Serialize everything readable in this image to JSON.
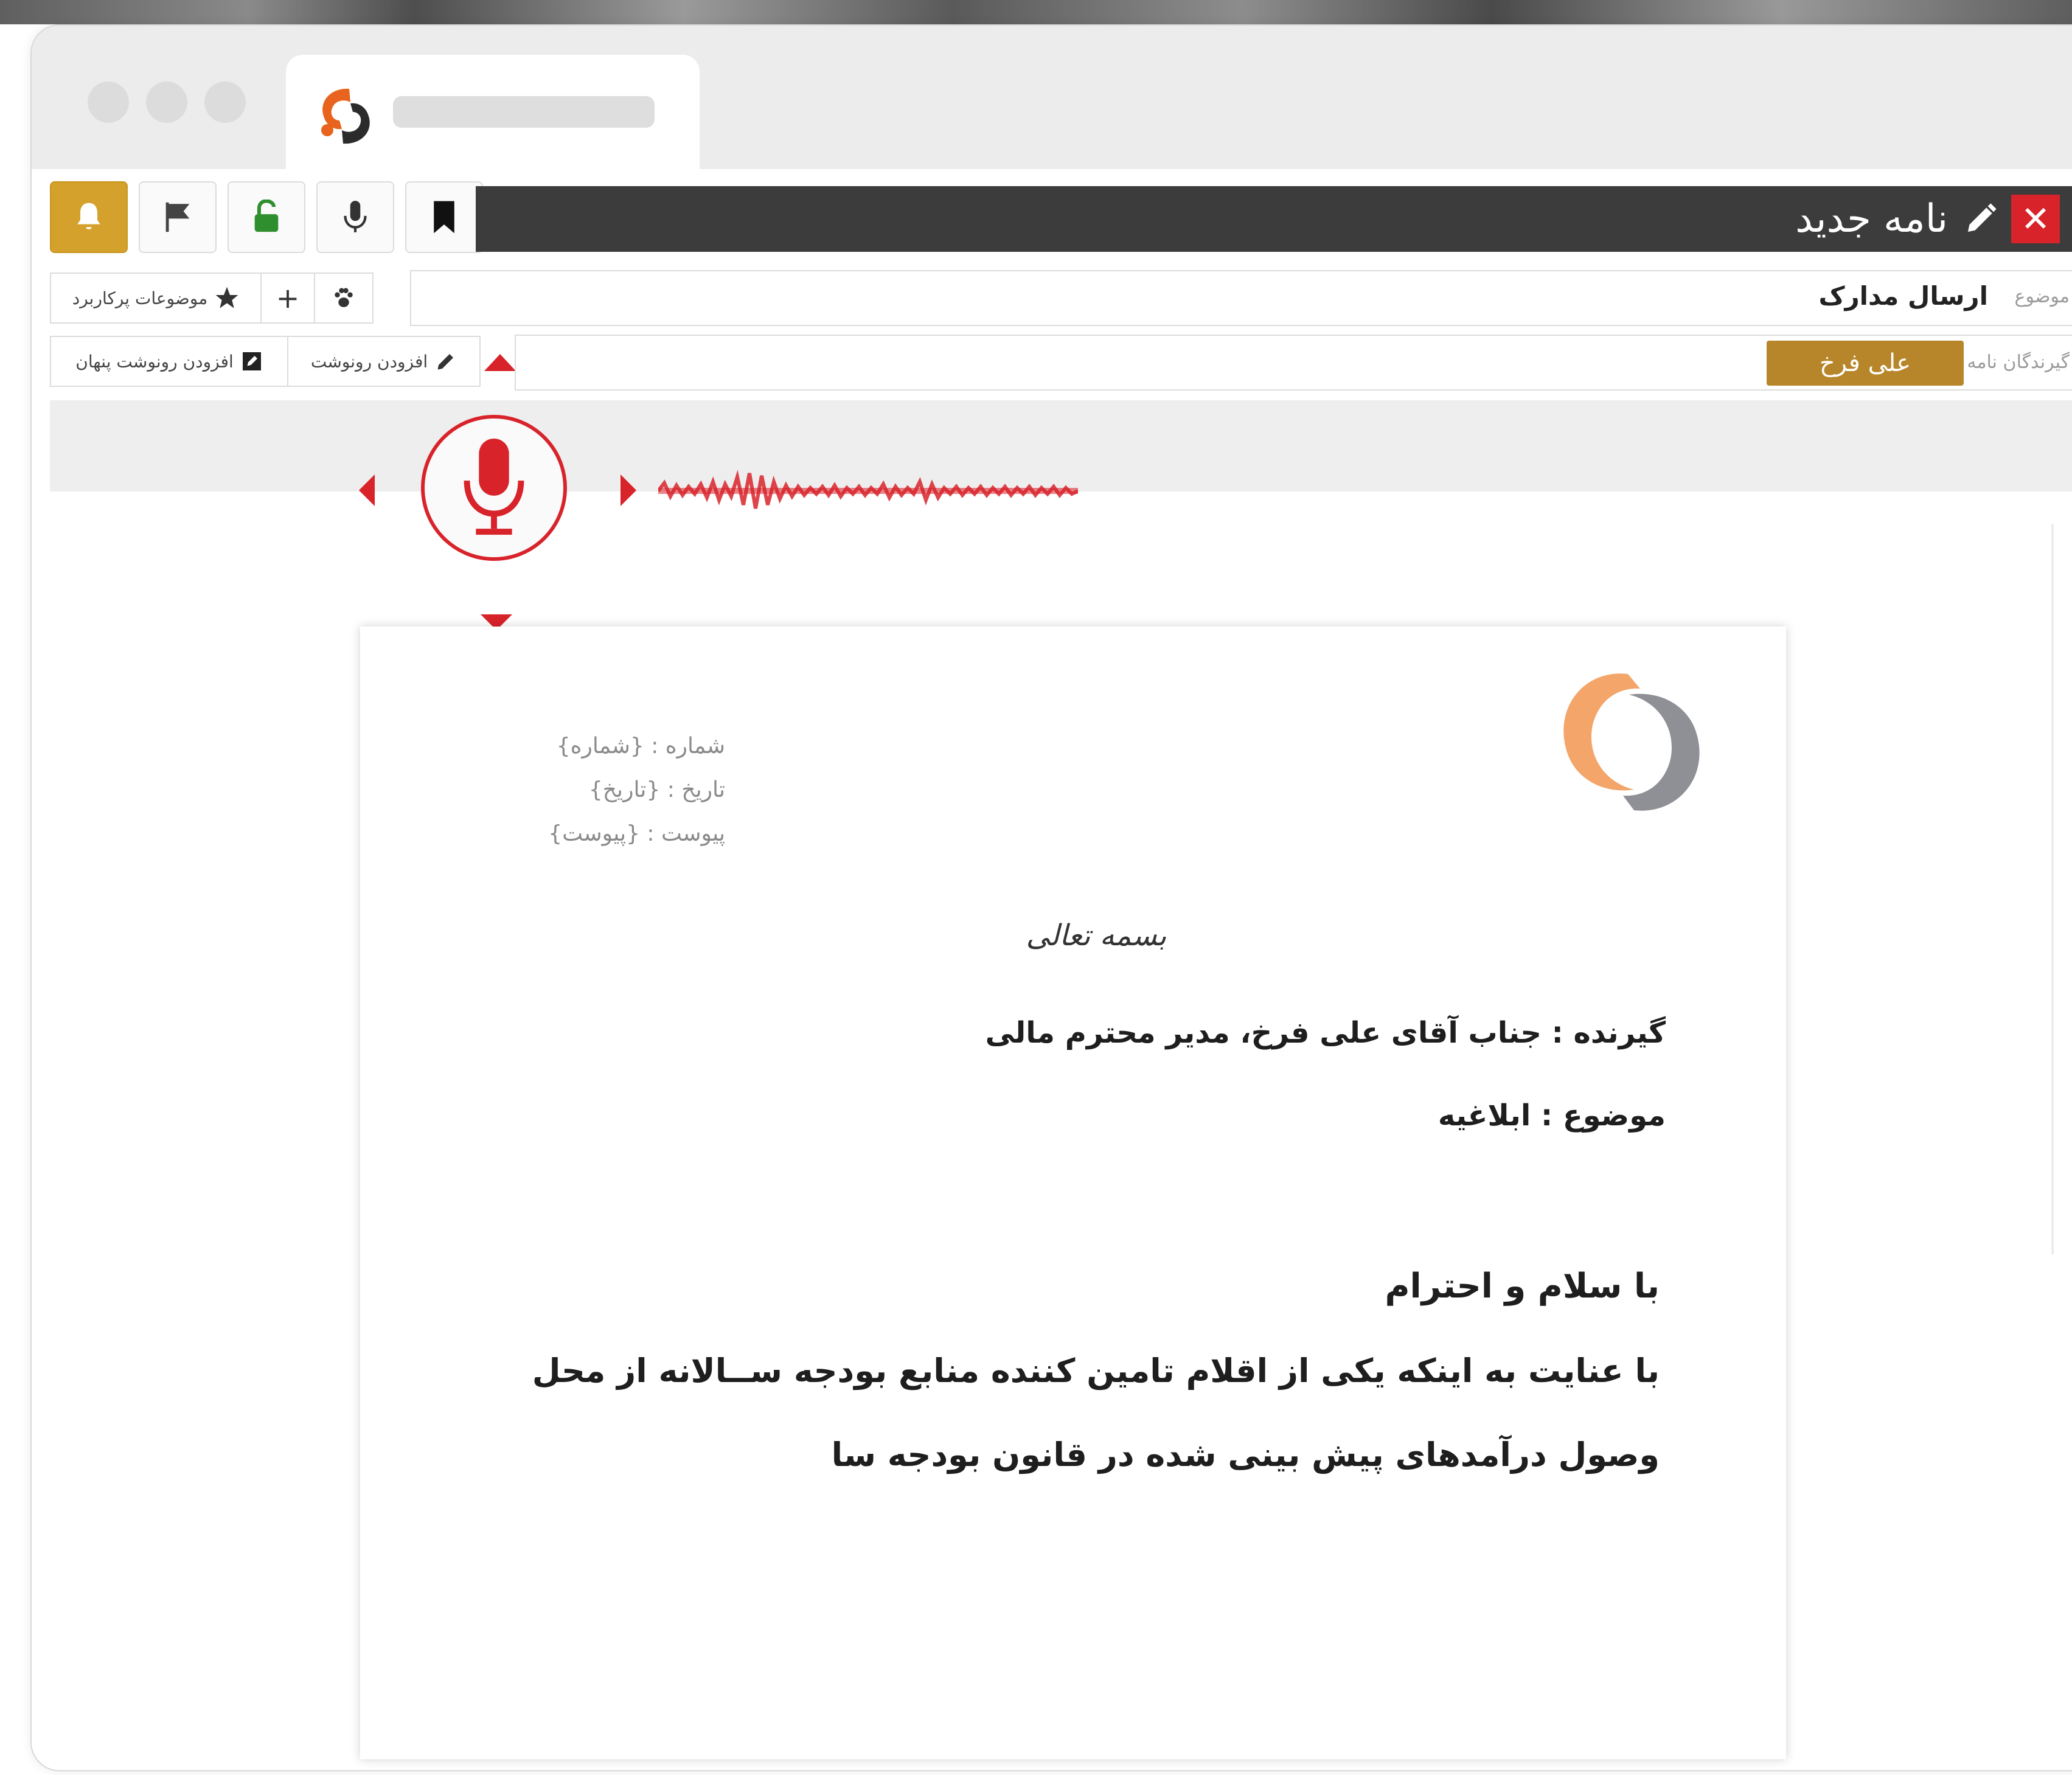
{
  "toolbar": {
    "bell_icon": "bell-icon",
    "flag_icon": "flag-icon",
    "lock_icon": "unlock-icon",
    "mic_icon": "microphone-icon",
    "bookmark_icon": "bookmark-icon",
    "bell_color": "#d4a22c"
  },
  "header": {
    "title": "نامه جدید",
    "close_label": "✕",
    "bar_color": "#3c3c3c",
    "close_color": "#d8232a"
  },
  "subject": {
    "label": "موضوع",
    "value": "ارسال مدارک",
    "frequent_label": "موضوعات پرکاربرد",
    "add_label": "+"
  },
  "recipients": {
    "label": "گیرندگان نامه",
    "chip": "علی فرخ",
    "add_cc_label": "افزودن رونوشت",
    "add_bcc_label": "افزودن رونوشت پنهان",
    "chip_color": "#b8862a"
  },
  "document": {
    "number_line": "شماره : {شماره}",
    "date_line": "تاریخ : {تاریخ}",
    "attachment_line": "پیوست : {پیوست}",
    "bismillah": "بسمه تعالی",
    "recipient_line": "گیرنده : جناب آقای علی فرخ، مدیر محترم مالی",
    "subject_line": "موضوع : ابلاغیه",
    "greeting": "با سلام و احترام",
    "body_line1": "با عنایت به اینکه یکی از اقلام تامین کننده منابع بودجه ســالانه از محل",
    "body_line2": "وصول درآمدهای پیش بینی شده در قانون بودجه سا"
  }
}
